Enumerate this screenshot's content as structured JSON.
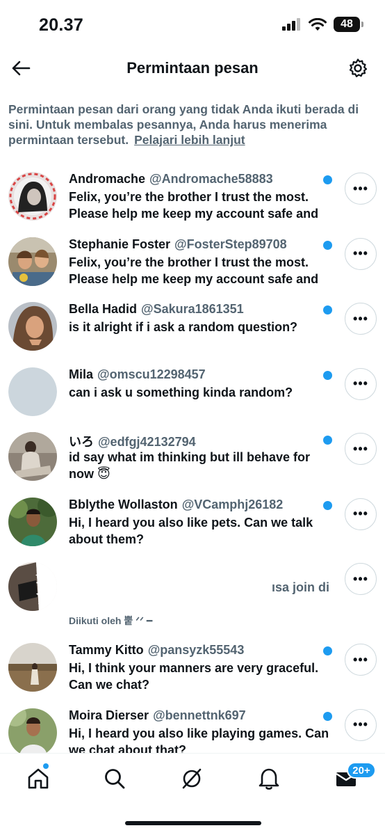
{
  "status_bar": {
    "time": "20.37",
    "battery": "48"
  },
  "header": {
    "title": "Permintaan pesan"
  },
  "notice": {
    "text": "Permintaan pesan dari orang yang tidak Anda ikuti berada di sini. Untuk membalas pesannya, Anda harus menerima permintaan tersebut.",
    "link": "Pelajari lebih lanjut"
  },
  "requests": [
    {
      "name": "Andromache",
      "handle": "@Andromache58883",
      "message": "Felix, you’re the brother I trust the most. Please help me keep my account safe and",
      "unread": true,
      "more": "•••"
    },
    {
      "name": "Stephanie Foster",
      "handle": "@FosterStep89708",
      "message": "Felix, you’re the brother I trust the most. Please help me keep my account safe and",
      "unread": true,
      "more": "•••"
    },
    {
      "name": "Bella Hadid",
      "handle": "@Sakura1861351",
      "message": "is it alright if i ask a random question?",
      "unread": true,
      "more": "•••"
    },
    {
      "name": "Mila",
      "handle": "@omscu12298457",
      "message": "can i ask u something kinda random?",
      "unread": true,
      "more": "•••"
    },
    {
      "name": "いろ",
      "handle": "@edfgj42132794",
      "message": "id say what im thinking but ill behave for now 😇",
      "unread": true,
      "more": "•••"
    },
    {
      "name": "Bblythe Wollaston",
      "handle": "@VCamphj26182",
      "message": "Hi, I heard you also like pets. Can we talk about them?",
      "unread": true,
      "more": "•••"
    },
    {
      "name": "",
      "handle": "",
      "message": "ısa join di",
      "followed_by": "Diikuti oleh 뿥 ᐟᐟ ━",
      "unread": false,
      "more": "•••"
    },
    {
      "name": "Tammy Kitto",
      "handle": "@pansyzk55543",
      "message": "Hi, I think your manners are very graceful. Can we chat?",
      "unread": true,
      "more": "•••"
    },
    {
      "name": "Moira Dierser",
      "handle": "@bennettnk697",
      "message": "Hi, I heard you also like playing games. Can we chat about that?",
      "unread": true,
      "more": "•••"
    }
  ],
  "bottom_nav": {
    "messages_badge": "20+"
  },
  "colors": {
    "accent": "#1d9bf0",
    "secondary_text": "#536471",
    "primary_text": "#0f1419"
  }
}
